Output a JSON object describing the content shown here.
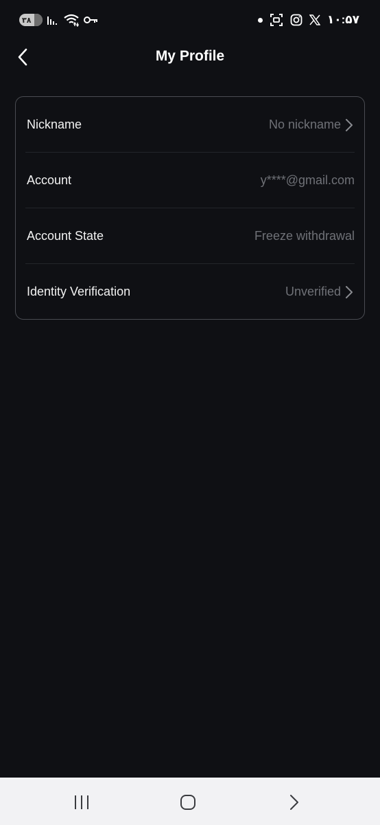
{
  "status_bar": {
    "battery_level": "۳۸",
    "time": "۱۰:۵۷",
    "icons": [
      "battery-icon",
      "signal-icon",
      "wifi-icon",
      "vpn-key-icon",
      "notification-dot-icon",
      "screenshot-icon",
      "instagram-icon",
      "x-icon"
    ]
  },
  "header": {
    "title": "My Profile",
    "back_icon": "chevron-left-icon"
  },
  "profile": {
    "rows": [
      {
        "label": "Nickname",
        "value": "No nickname",
        "has_chevron": true
      },
      {
        "label": "Account",
        "value": "y****@gmail.com",
        "has_chevron": false
      },
      {
        "label": "Account State",
        "value": "Freeze withdrawal",
        "has_chevron": false
      },
      {
        "label": "Identity Verification",
        "value": "Unverified",
        "has_chevron": true
      }
    ]
  },
  "nav_bar": {
    "icons": [
      "recent-apps-icon",
      "home-icon",
      "back-icon"
    ]
  },
  "colors": {
    "background": "#0f1014",
    "card_border": "#4a4c52",
    "label": "#f2f2f2",
    "value": "#6f7177",
    "nav_bar": "#f2f2f4"
  }
}
